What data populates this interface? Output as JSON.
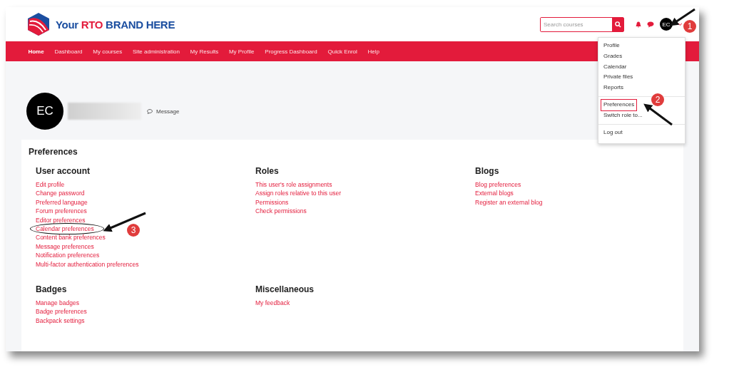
{
  "brand": {
    "prefix": "Your ",
    "highlight": "RTO",
    "suffix": " BRAND HERE"
  },
  "search": {
    "placeholder": "Search courses"
  },
  "user": {
    "initials": "EC"
  },
  "nav": [
    {
      "label": "Home",
      "selected": true
    },
    {
      "label": "Dashboard",
      "selected": false
    },
    {
      "label": "My courses",
      "selected": false
    },
    {
      "label": "Site administration",
      "selected": false
    },
    {
      "label": "My Results",
      "selected": false
    },
    {
      "label": "My Profile",
      "selected": false
    },
    {
      "label": "Progress Dashboard",
      "selected": false
    },
    {
      "label": "Quick Enrol",
      "selected": false
    },
    {
      "label": "Help",
      "selected": false
    }
  ],
  "user_menu": {
    "groups": [
      [
        {
          "label": "Profile",
          "selected": false
        },
        {
          "label": "Grades",
          "selected": false
        },
        {
          "label": "Calendar",
          "selected": false
        },
        {
          "label": "Private files",
          "selected": false
        },
        {
          "label": "Reports",
          "selected": false
        }
      ],
      [
        {
          "label": "Preferences",
          "selected": true
        },
        {
          "label": "Switch role to...",
          "selected": false
        }
      ],
      [
        {
          "label": "Log out",
          "selected": false
        }
      ]
    ]
  },
  "profile": {
    "initials": "EC",
    "message": "Message"
  },
  "preferences": {
    "title": "Preferences",
    "sections": [
      {
        "title": "User account",
        "links": [
          {
            "label": "Edit profile",
            "circled": false
          },
          {
            "label": "Change password",
            "circled": false
          },
          {
            "label": "Preferred language",
            "circled": false
          },
          {
            "label": "Forum preferences",
            "circled": false
          },
          {
            "label": "Editor preferences",
            "circled": false
          },
          {
            "label": "Calendar preferences",
            "circled": true
          },
          {
            "label": "Content bank preferences",
            "circled": false
          },
          {
            "label": "Message preferences",
            "circled": false
          },
          {
            "label": "Notification preferences",
            "circled": false
          },
          {
            "label": "Multi-factor authentication preferences",
            "circled": false
          }
        ]
      },
      {
        "title": "Roles",
        "links": [
          {
            "label": "This user's role assignments",
            "circled": false
          },
          {
            "label": "Assign roles relative to this user",
            "circled": false
          },
          {
            "label": "Permissions",
            "circled": false
          },
          {
            "label": "Check permissions",
            "circled": false
          }
        ]
      },
      {
        "title": "Blogs",
        "links": [
          {
            "label": "Blog preferences",
            "circled": false
          },
          {
            "label": "External blogs",
            "circled": false
          },
          {
            "label": "Register an external blog",
            "circled": false
          }
        ]
      },
      {
        "title": "Badges",
        "links": [
          {
            "label": "Manage badges",
            "circled": false
          },
          {
            "label": "Badge preferences",
            "circled": false
          },
          {
            "label": "Backpack settings",
            "circled": false
          }
        ]
      },
      {
        "title": "Miscellaneous",
        "links": [
          {
            "label": "My feedback",
            "circled": false
          }
        ]
      }
    ]
  },
  "annotations": [
    {
      "number": "1"
    },
    {
      "number": "2"
    },
    {
      "number": "3"
    }
  ]
}
